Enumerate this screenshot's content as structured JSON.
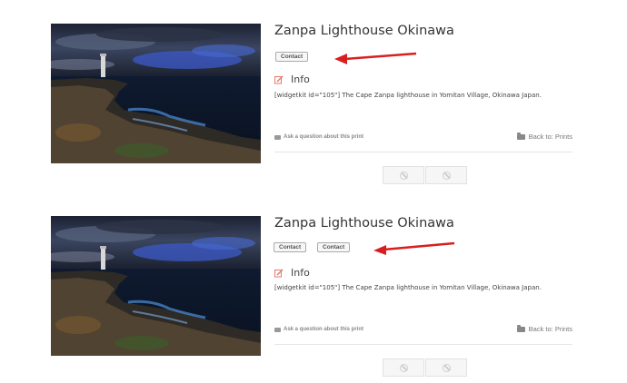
{
  "items": [
    {
      "title": "Zanpa Lighthouse Okinawa",
      "contact_buttons": [
        "Contact"
      ],
      "info_label": "Info",
      "description": "[widgetkit id=\"105\"] The Cape Zanpa lighthouse in Yomitan Village, Okinawa Japan.",
      "ask_label": "Ask a question about this print",
      "back_label": "Back to: Prints"
    },
    {
      "title": "Zanpa Lighthouse Okinawa",
      "contact_buttons": [
        "Contact",
        "Contact"
      ],
      "info_label": "Info",
      "description": "[widgetkit id=\"105\"] The Cape Zanpa lighthouse in Yomitan Village, Okinawa Japan.",
      "ask_label": "Ask a question about this print",
      "back_label": "Back to: Prints"
    }
  ],
  "icons": {
    "info": "edit-icon",
    "ask": "envelope-icon",
    "back": "folder-icon",
    "pager": "ban-icon",
    "annotation": "red-arrow"
  },
  "colors": {
    "arrow": "#d81f1f",
    "info_icon": "#e07a6a"
  }
}
